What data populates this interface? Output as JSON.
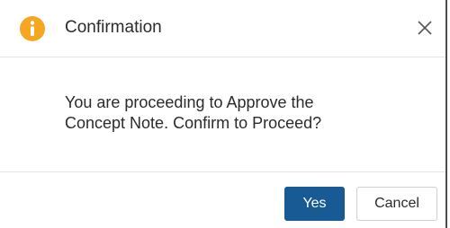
{
  "dialog": {
    "title": "Confirmation",
    "icon": "info-icon",
    "close_icon": "close-icon",
    "message_line1": "You are proceeding to Approve the",
    "message_line2": "Concept Note. Confirm to Proceed?",
    "buttons": {
      "yes_label": "Yes",
      "cancel_label": "Cancel"
    }
  },
  "colors": {
    "info_icon": "#f5a623",
    "primary_button": "#175a94",
    "text": "#2b2b2b"
  }
}
